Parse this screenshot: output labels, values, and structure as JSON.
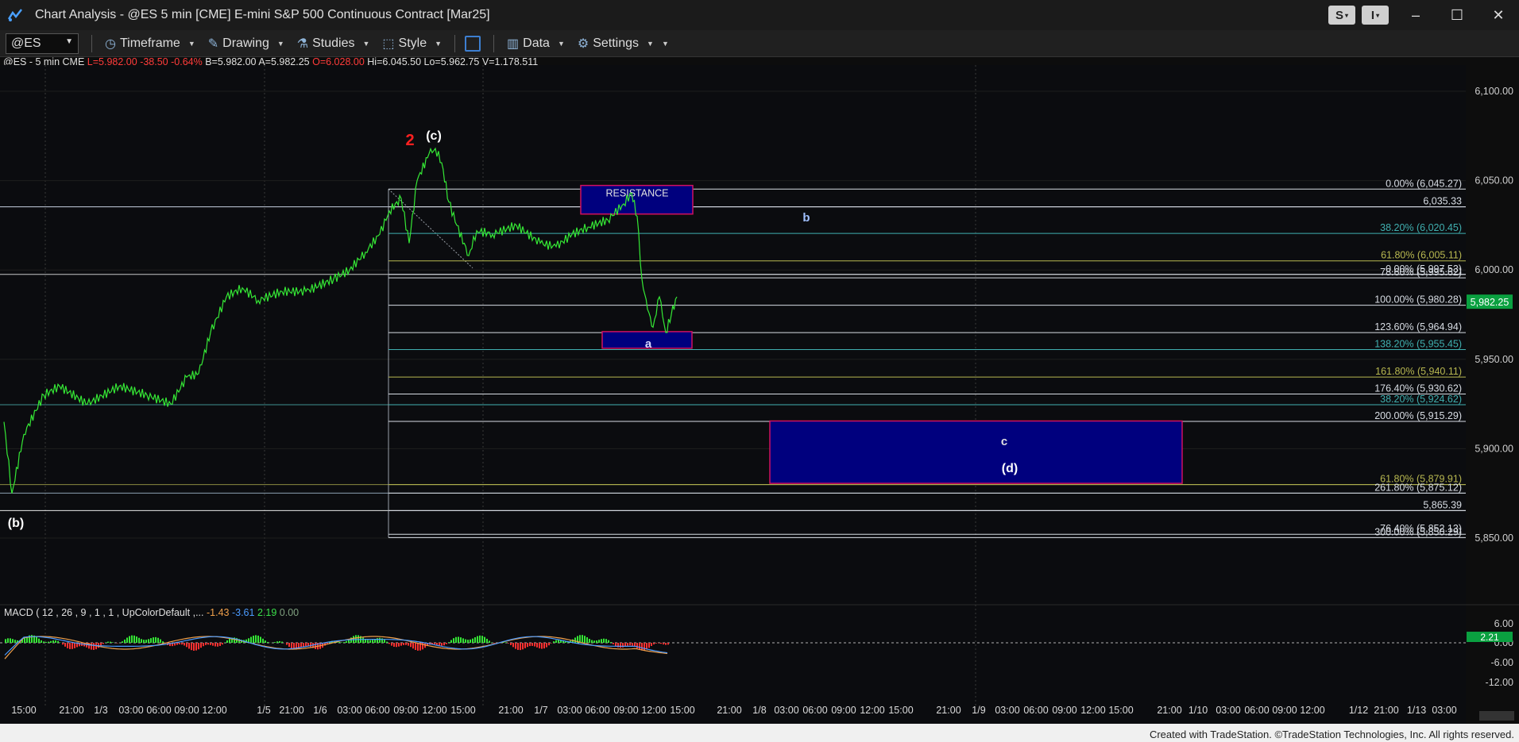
{
  "window": {
    "title": "Chart Analysis - @ES 5 min [CME] E-mini S&P 500 Continuous Contract [Mar25]",
    "s_button": "S",
    "i_button": "I",
    "minimize": "–",
    "maximize": "☐",
    "close": "✕"
  },
  "toolbar": {
    "symbol": "@ES",
    "timeframe_label": "Timeframe",
    "drawing_label": "Drawing",
    "studies_label": "Studies",
    "style_label": "Style",
    "data_label": "Data",
    "settings_label": "Settings"
  },
  "info": {
    "symbol": "@ES - 5 min  CME",
    "last": "L=5,982.00",
    "change": "-38.50",
    "change_pct": "-0.64%",
    "bid": "B=5,982.00",
    "ask": "A=5,982.25",
    "open": "O=6,028.00",
    "high": "Hi=6,045.50",
    "low": "Lo=5,962.75",
    "volume": "V=1,178,511"
  },
  "macd": {
    "label": "MACD ( 12 , 26 , 9 , 1 , 1 , UpColorDefault ,...",
    "v1": "-1.43",
    "v2": "-3.61",
    "v3": "2.19",
    "v4": "0.00"
  },
  "footer": "Created with TradeStation. ©TradeStation Technologies, Inc. All rights reserved.",
  "colors": {
    "price": "#35e835",
    "up": "#35e835",
    "down": "#ff3030",
    "zone": "#00007e",
    "fib": "#c0c8d0"
  },
  "chart_data": {
    "type": "line",
    "price_axis": {
      "min": 5800,
      "max": 6100,
      "ticks": [
        "6,100.00",
        "6,050.00",
        "6,000.00",
        "5,950.00",
        "5,900.00",
        "5,850.00"
      ]
    },
    "last_price_label": "5,982.25",
    "x_ticks": [
      "15:00",
      "21:00",
      "1/3",
      "03:00",
      "06:00",
      "09:00",
      "12:00",
      "1/5",
      "21:00",
      "1/6",
      "03:00",
      "06:00",
      "09:00",
      "12:00",
      "15:00",
      "21:00",
      "1/7",
      "03:00",
      "06:00",
      "09:00",
      "12:00",
      "15:00",
      "21:00",
      "1/8",
      "03:00",
      "06:00",
      "09:00",
      "12:00",
      "15:00",
      "21:00",
      "1/9",
      "03:00",
      "06:00",
      "09:00",
      "12:00",
      "15:00",
      "21:00",
      "1/10",
      "03:00",
      "06:00",
      "09:00",
      "12:00",
      "1/12",
      "21:00",
      "1/13",
      "03:00"
    ],
    "fib_levels": [
      {
        "label": "0.00% (6,045.27)",
        "value": 6045.27
      },
      {
        "label": "6,035.33",
        "value": 6035.33
      },
      {
        "label": "38.20% (6,020.45)",
        "value": 6020.45
      },
      {
        "label": "61.80% (6,005.11)",
        "value": 6005.11
      },
      {
        "label": "0.00% (5,997.53)",
        "value": 5997.53
      },
      {
        "label": "78.60% (5,995.62)",
        "value": 5995.62
      },
      {
        "label": "100.00% (5,980.28)",
        "value": 5980.28
      },
      {
        "label": "123.60% (5,964.94)",
        "value": 5964.94
      },
      {
        "label": "138.20% (5,955.45)",
        "value": 5955.45
      },
      {
        "label": "161.80% (5,940.11)",
        "value": 5940.11
      },
      {
        "label": "176.40% (5,930.62)",
        "value": 5930.62
      },
      {
        "label": "38.20% (5,924.62)",
        "value": 5924.62
      },
      {
        "label": "200.00% (5,915.29)",
        "value": 5915.29
      },
      {
        "label": "61.80% (5,879.91)",
        "value": 5879.91
      },
      {
        "label": "261.80% (5,875.12)",
        "value": 5875.12
      },
      {
        "label": "5,865.39",
        "value": 5865.39
      },
      {
        "label": "76.40% (5,852.13)",
        "value": 5852.13
      },
      {
        "label": "300.00% (5,850.29)",
        "value": 5850.29
      }
    ],
    "annotations": [
      "2",
      "(c)",
      "(b)",
      "RESISTANCE",
      "a",
      "b",
      "c",
      "(d)"
    ],
    "macd_axis": [
      "6.00",
      "0.00",
      "-6.00",
      "-12.00"
    ],
    "macd_value_label": "2.21"
  }
}
